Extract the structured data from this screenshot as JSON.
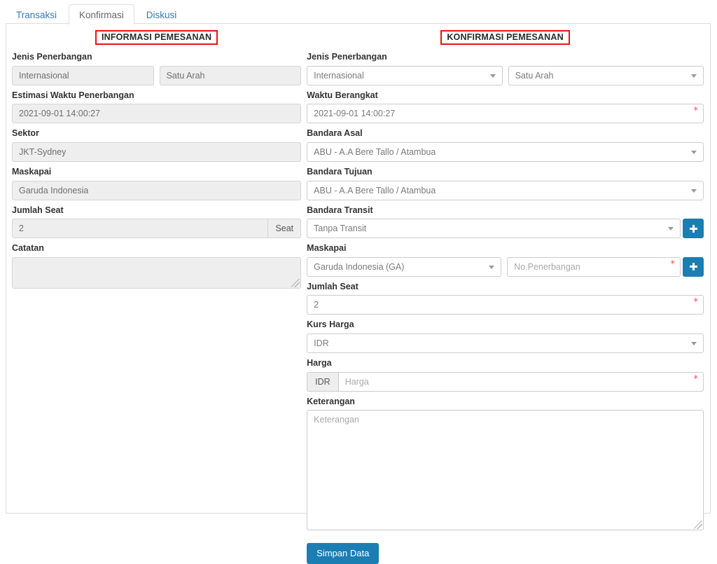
{
  "tabs": [
    {
      "label": "Transaksi",
      "active": false
    },
    {
      "label": "Konfirmasi",
      "active": true
    },
    {
      "label": "Diskusi",
      "active": false
    }
  ],
  "colors": {
    "accent_blue": "#1b7eb3",
    "link_blue": "#337ab7",
    "required_red": "#f05050",
    "header_border_red": "#ee1111",
    "disabled_bg": "#eeeeee"
  },
  "left_panel": {
    "title": "INFORMASI PEMESANAN",
    "jenis_penerbangan_label": "Jenis Penerbangan",
    "jenis_penerbangan_value": "Internasional",
    "arah_value": "Satu Arah",
    "estimasi_label": "Estimasi Waktu Penerbangan",
    "estimasi_value": "2021-09-01 14:00:27",
    "sektor_label": "Sektor",
    "sektor_value": "JKT-Sydney",
    "maskapai_label": "Maskapai",
    "maskapai_value": "Garuda Indonesia",
    "jumlah_seat_label": "Jumlah Seat",
    "jumlah_seat_value": "2",
    "seat_addon": "Seat",
    "catatan_label": "Catatan",
    "catatan_value": ""
  },
  "right_panel": {
    "title": "KONFIRMASI PEMESANAN",
    "jenis_penerbangan_label": "Jenis Penerbangan",
    "jenis_penerbangan_value": "Internasional",
    "arah_value": "Satu Arah",
    "waktu_berangkat_label": "Waktu Berangkat",
    "waktu_berangkat_value": "2021-09-01 14:00:27",
    "bandara_asal_label": "Bandara Asal",
    "bandara_asal_value": "ABU - A.A Bere Tallo / Atambua",
    "bandara_tujuan_label": "Bandara Tujuan",
    "bandara_tujuan_value": "ABU - A.A Bere Tallo / Atambua",
    "bandara_transit_label": "Bandara Transit",
    "bandara_transit_value": "Tanpa Transit",
    "maskapai_label": "Maskapai",
    "maskapai_value": "Garuda Indonesia (GA)",
    "no_penerbangan_placeholder": "No.Penerbangan",
    "no_penerbangan_value": "",
    "jumlah_seat_label": "Jumlah Seat",
    "jumlah_seat_value": "2",
    "kurs_harga_label": "Kurs Harga",
    "kurs_harga_value": "IDR",
    "harga_label": "Harga",
    "harga_prefix": "IDR",
    "harga_placeholder": "Harga",
    "harga_value": "",
    "keterangan_label": "Keterangan",
    "keterangan_placeholder": "Keterangan",
    "keterangan_value": "",
    "submit_label": "Simpan Data",
    "required_marker": "*"
  }
}
